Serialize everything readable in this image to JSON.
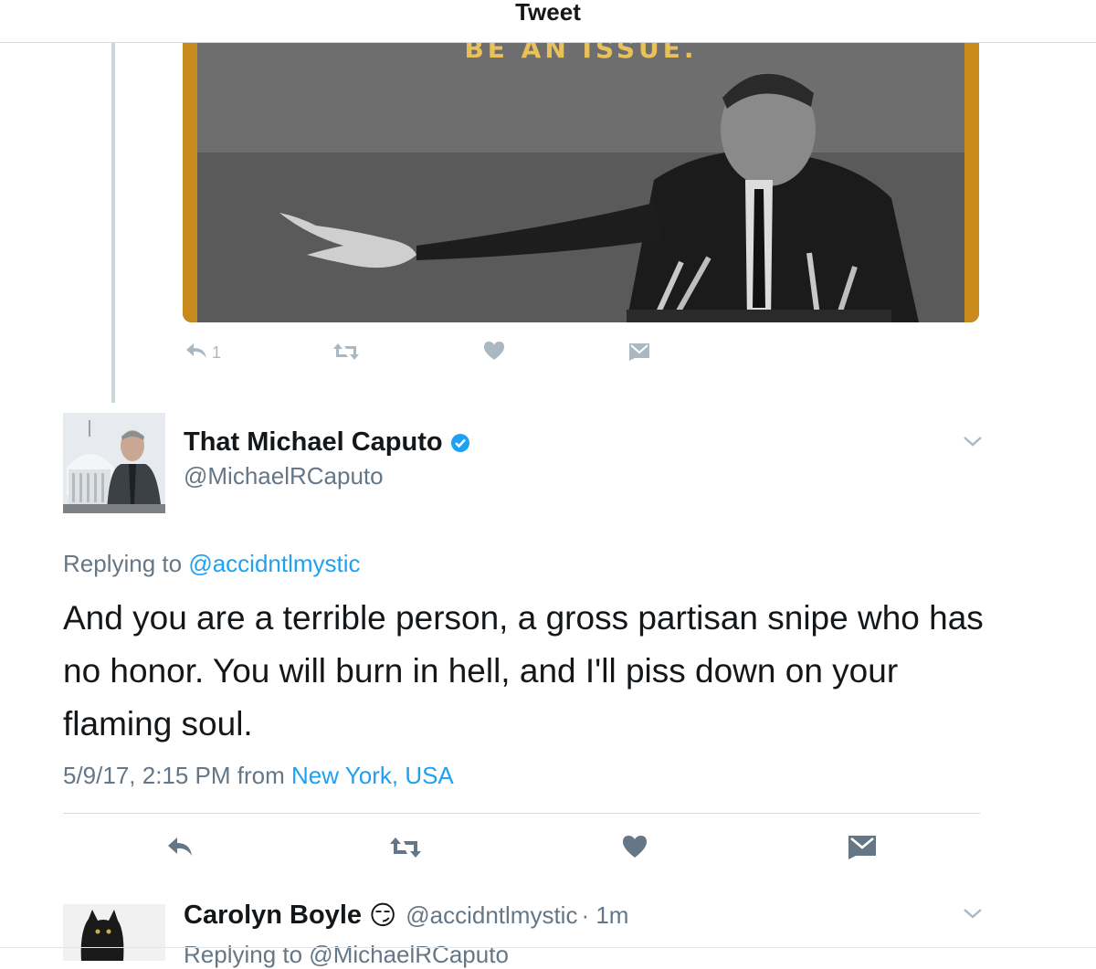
{
  "header": {
    "title": "Tweet"
  },
  "media": {
    "caption": "BE AN ISSUE."
  },
  "parent_actions": {
    "reply_count": "1"
  },
  "tweet": {
    "display_name": "That Michael Caputo",
    "handle": "@MichaelRCaputo",
    "replying_prefix": "Replying to",
    "replying_to": "@accidntlmystic",
    "text": "And you are a terrible person, a gross partisan snipe who has no honor. You will burn in hell, and I'll piss down on your flaming soul.",
    "timestamp": "5/9/17, 2:15 PM",
    "from_prefix": "from",
    "location": "New York, USA"
  },
  "reply": {
    "display_name": "Carolyn Boyle",
    "emoji": "😏",
    "handle": "@accidntlmystic",
    "age": "· 1m",
    "sub_text": "Replying to @MichaelRCaputo"
  },
  "colors": {
    "accent": "#1da1f2",
    "muted": "#657786",
    "icon": "#aab8c2",
    "icon_dark": "#657786"
  },
  "icons": [
    "reply-icon",
    "retweet-icon",
    "like-icon",
    "dm-icon",
    "chevron-down-icon",
    "verified-icon"
  ]
}
